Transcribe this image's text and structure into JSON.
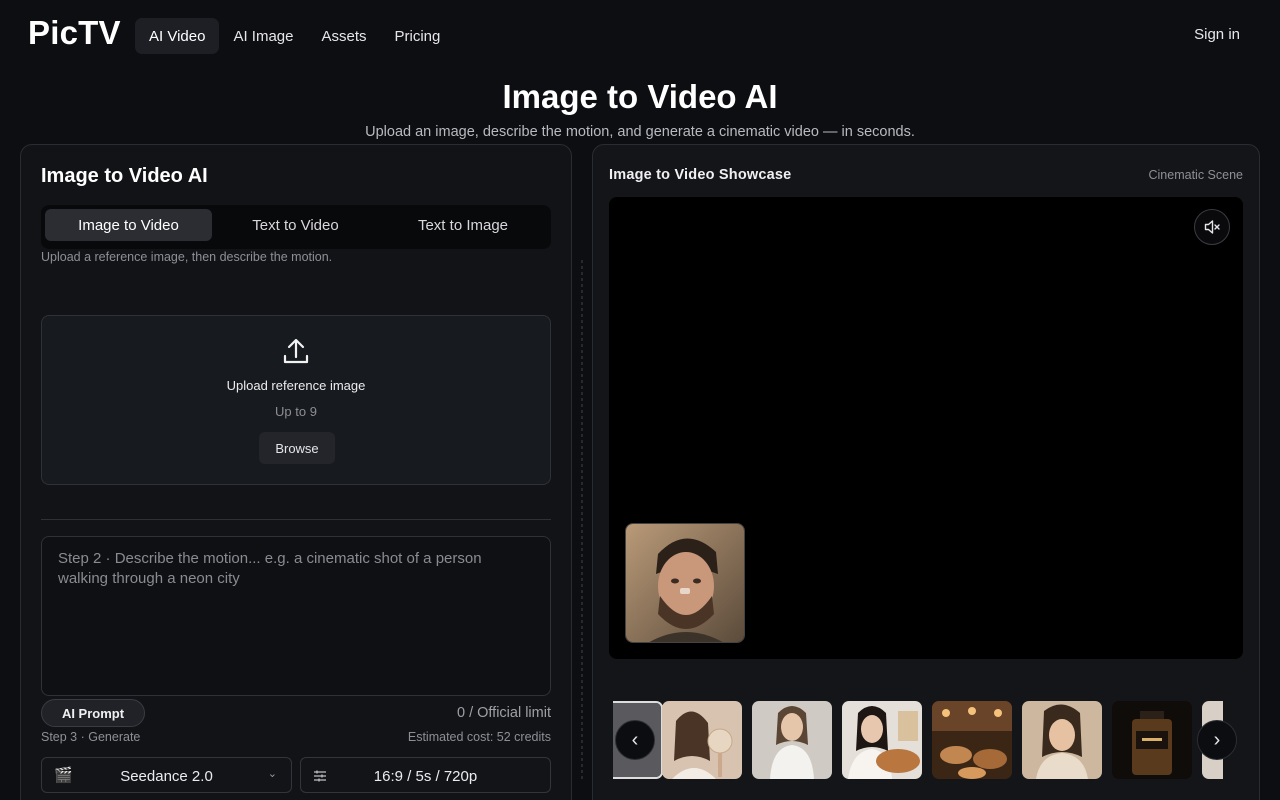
{
  "header": {
    "logo": "PicTV",
    "nav": [
      {
        "label": "AI Video",
        "active": true
      },
      {
        "label": "AI Image",
        "active": false
      },
      {
        "label": "Assets",
        "active": false
      },
      {
        "label": "Pricing",
        "active": false
      }
    ],
    "signin": "Sign in"
  },
  "hero": {
    "title": "Image to Video AI",
    "subtitle": "Upload an image, describe the motion, and generate a cinematic video — in seconds."
  },
  "left": {
    "title": "Image to Video AI",
    "tabs": [
      "Image to Video",
      "Text to Video",
      "Text to Image"
    ],
    "active_tab": "Image to Video",
    "hint": "Upload a reference image, then describe the motion.",
    "upload": {
      "label": "Upload reference image",
      "sub": "Up to 9",
      "browse": "Browse"
    },
    "prompt_placeholder": "Step 2 · Describe the motion... e.g. a cinematic shot of a person walking through a neon city",
    "ai_prompt": "AI Prompt",
    "limit": "0 / Official limit",
    "step3": "Step 3 · Generate",
    "cost": "Estimated cost: 52 credits",
    "model": "Seedance 2.0",
    "settings": "16:9 / 5s / 720p"
  },
  "right": {
    "title": "Image to Video Showcase",
    "caption": "Cinematic Scene",
    "thumbnails": [
      "woman-fan",
      "woman-white-top",
      "woman-noodles",
      "restaurant-food",
      "woman-portrait",
      "perfume-bottle"
    ]
  },
  "icons": {
    "upload": "upload-icon",
    "mute": "muted-speaker-icon",
    "clapper": "clapperboard-icon",
    "sliders": "sliders-icon",
    "prev": "chevron-left-icon",
    "next": "chevron-right-icon"
  },
  "colors": {
    "background": "#0d0e12",
    "panel": "#121317",
    "accent_tab": "#2b2d33"
  }
}
